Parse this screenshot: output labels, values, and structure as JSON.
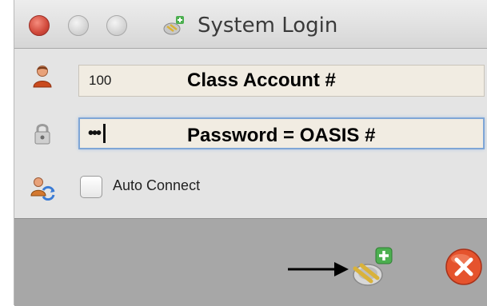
{
  "window": {
    "title": "System Login",
    "title_icon": "network-login-icon"
  },
  "form": {
    "account": {
      "value": "100",
      "icon": "user-icon",
      "annotation": "Class Account #"
    },
    "password": {
      "masked_value": "•••",
      "icon": "padlock-icon",
      "annotation": "Password = OASIS #"
    },
    "auto_connect": {
      "label": "Auto Connect",
      "checked": false,
      "icon": "user-sync-icon"
    }
  },
  "footer": {
    "connect_icon": "plug-add-icon",
    "cancel_icon": "close-red-icon",
    "annotation_arrow": "right-arrow-icon"
  },
  "colors": {
    "close_button": "#d0483a",
    "field_background": "#f1ece2",
    "focus_ring": "#7fa6d6",
    "footer_background": "#a7a7a7"
  }
}
